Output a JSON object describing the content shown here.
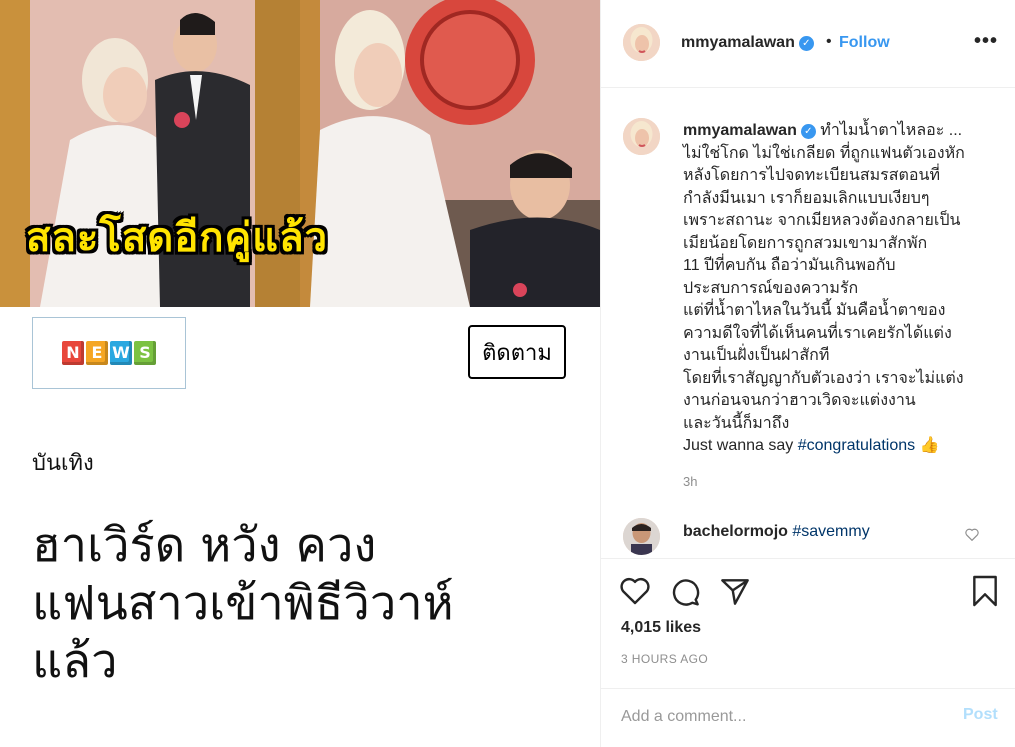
{
  "media": {
    "banner_text": "สละโสดอีกคู่แล้ว",
    "news_letters": [
      "N",
      "E",
      "W",
      "S"
    ],
    "news_colors": [
      "#e8473b",
      "#f5a623",
      "#2aa8e0",
      "#7cc242"
    ],
    "follow_label": "ติดตาม",
    "category": "บันเทิง",
    "headline_lines": [
      "ฮาเวิร์ด หวัง ควง",
      "แฟนสาวเข้าพิธีวิวาห์",
      "แล้ว"
    ]
  },
  "header": {
    "username": "mmyamalawan",
    "verified": true,
    "separator": "•",
    "follow_label": "Follow",
    "more_icon": "more-icon"
  },
  "caption": {
    "username": "mmyamalawan",
    "lines": [
      "ทำไมน้ำตาไหลอะ ...",
      "ไม่ใช่โกด ไม่ใช่เกลียด ที่ถูกแฟนตัวเองหัก",
      "หลังโดยการไปจดทะเบียนสมรสตอนที่",
      "กำลังมีนเมา เราก็ยอมเลิกแบบเงียบๆ",
      "เพราะสถานะ จากเมียหลวงต้องกลายเป็น",
      "เมียน้อยโดยการถูกสวมเขามาสักพัก",
      "11 ปีที่คบกัน ถือว่ามันเกินพอกับ",
      "ประสบการณ์ของความรัก",
      "แต่ที่น้ำตาไหลในวันนี้ มันคือน้ำตาของ",
      "ความดีใจที่ได้เห็นคนที่เราเคยรักได้แต่ง",
      "งานเป็นฝั่งเป็นฝาสักที",
      "โดยที่เราสัญญากับตัวเองว่า เราจะไม่แต่ง",
      "งานก่อนจนกว่าฮาวเวิดจะแต่งงาน",
      "และวันนี้ก็มาถึง"
    ],
    "last_line_text": "Just wanna say ",
    "last_line_hashtag": "#congratulations",
    "last_line_emoji": "👍",
    "time": "3h"
  },
  "comments": [
    {
      "username": "bachelormojo",
      "text": "#savemmy"
    }
  ],
  "actions": {
    "likes": "4,015 likes",
    "posted": "3 HOURS AGO"
  },
  "add_comment": {
    "placeholder": "Add a comment...",
    "post_label": "Post"
  },
  "colors": {
    "accent": "#3897f0",
    "banner_yellow": "#ffe400",
    "muted": "#8e8e8e",
    "post_disabled": "#b2dffc"
  }
}
